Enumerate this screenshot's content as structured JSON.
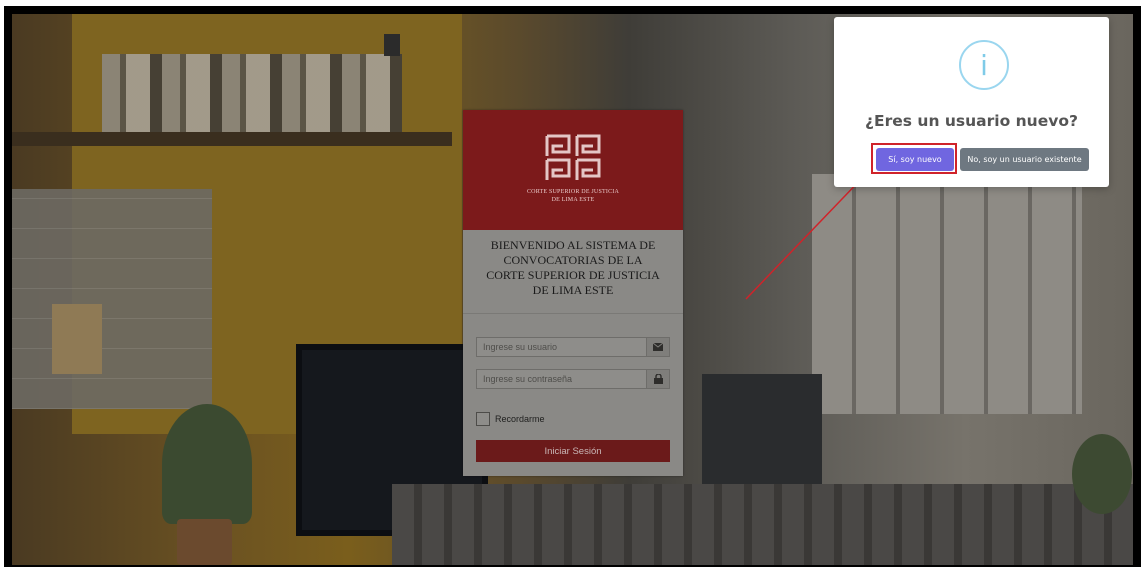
{
  "login": {
    "logo_caption_line1": "CORTE SUPERIOR DE JUSTICIA",
    "logo_caption_line2": "DE LIMA ESTE",
    "welcome_text": "BIENVENIDO AL SISTEMA DE CONVOCATORIAS DE LA CORTE SUPERIOR DE JUSTICIA DE LIMA ESTE",
    "username_placeholder": "Ingrese su usuario",
    "username_icon": "envelope-icon",
    "password_placeholder": "Ingrese su contraseña",
    "password_icon": "lock-icon",
    "remember_label": "Recordarme",
    "submit_label": "Iniciar Sesión",
    "header_color": "#7c1a1b"
  },
  "dialog": {
    "icon": "info-icon",
    "icon_glyph": "i",
    "title": "¿Eres un usuario nuevo?",
    "confirm_label": "Sí, soy nuevo",
    "deny_label": "No, soy un usuario existente",
    "confirm_color": "#7066e0",
    "deny_color": "#6e7881",
    "highlight_color": "#d0232a"
  }
}
